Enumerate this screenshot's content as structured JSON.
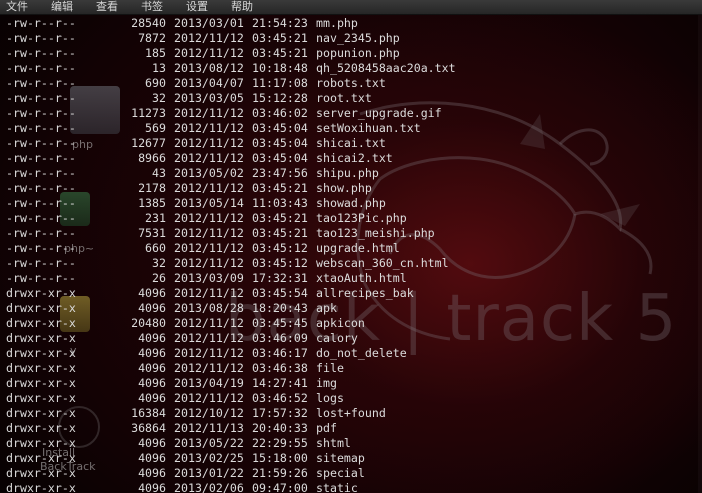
{
  "menubar": {
    "items": [
      "文件",
      "编辑",
      "查看",
      "书签",
      "设置",
      "帮助"
    ]
  },
  "desktop": {
    "watermark_text": "back | track 5",
    "icons": [
      {
        "label": "php"
      },
      {
        "label": "php~"
      },
      {
        "label": "y"
      },
      {
        "label": "Install"
      },
      {
        "label": "BackTrack"
      }
    ]
  },
  "listing": [
    {
      "perm": "-rw-r--r--",
      "size": "28540",
      "date": "2013/03/01",
      "time": "21:54:23",
      "name": "mm.php"
    },
    {
      "perm": "-rw-r--r--",
      "size": "7872",
      "date": "2012/11/12",
      "time": "03:45:21",
      "name": "nav_2345.php"
    },
    {
      "perm": "-rw-r--r--",
      "size": "185",
      "date": "2012/11/12",
      "time": "03:45:21",
      "name": "popunion.php"
    },
    {
      "perm": "-rw-r--r--",
      "size": "13",
      "date": "2013/08/12",
      "time": "10:18:48",
      "name": "qh_5208458aac20a.txt"
    },
    {
      "perm": "-rw-r--r--",
      "size": "690",
      "date": "2013/04/07",
      "time": "11:17:08",
      "name": "robots.txt"
    },
    {
      "perm": "-rw-r--r--",
      "size": "32",
      "date": "2013/03/05",
      "time": "15:12:28",
      "name": "root.txt"
    },
    {
      "perm": "-rw-r--r--",
      "size": "11273",
      "date": "2012/11/12",
      "time": "03:46:02",
      "name": "server_upgrade.gif"
    },
    {
      "perm": "-rw-r--r--",
      "size": "569",
      "date": "2012/11/12",
      "time": "03:45:04",
      "name": "setWoxihuan.txt"
    },
    {
      "perm": "-rw-r--r--",
      "size": "12677",
      "date": "2012/11/12",
      "time": "03:45:04",
      "name": "shicai.txt"
    },
    {
      "perm": "-rw-r--r--",
      "size": "8966",
      "date": "2012/11/12",
      "time": "03:45:04",
      "name": "shicai2.txt"
    },
    {
      "perm": "-rw-r--r--",
      "size": "43",
      "date": "2013/05/02",
      "time": "23:47:56",
      "name": "shipu.php"
    },
    {
      "perm": "-rw-r--r--",
      "size": "2178",
      "date": "2012/11/12",
      "time": "03:45:21",
      "name": "show.php"
    },
    {
      "perm": "-rw-r--r--",
      "size": "1385",
      "date": "2013/05/14",
      "time": "11:03:43",
      "name": "showad.php"
    },
    {
      "perm": "-rw-r--r--",
      "size": "231",
      "date": "2012/11/12",
      "time": "03:45:21",
      "name": "tao123Pic.php"
    },
    {
      "perm": "-rw-r--r--",
      "size": "7531",
      "date": "2012/11/12",
      "time": "03:45:21",
      "name": "tao123_meishi.php"
    },
    {
      "perm": "-rw-r--r--",
      "size": "660",
      "date": "2012/11/12",
      "time": "03:45:12",
      "name": "upgrade.html"
    },
    {
      "perm": "-rw-r--r--",
      "size": "32",
      "date": "2012/11/12",
      "time": "03:45:12",
      "name": "webscan_360_cn.html"
    },
    {
      "perm": "-rw-r--r--",
      "size": "26",
      "date": "2013/03/09",
      "time": "17:32:31",
      "name": "xtaoAuth.html"
    },
    {
      "perm": "drwxr-xr-x",
      "size": "4096",
      "date": "2012/11/12",
      "time": "03:45:54",
      "name": "allrecipes_bak"
    },
    {
      "perm": "drwxr-xr-x",
      "size": "4096",
      "date": "2013/08/28",
      "time": "18:20:43",
      "name": "apk"
    },
    {
      "perm": "drwxr-xr-x",
      "size": "20480",
      "date": "2012/11/12",
      "time": "03:45:45",
      "name": "apkicon"
    },
    {
      "perm": "drwxr-xr-x",
      "size": "4096",
      "date": "2012/11/12",
      "time": "03:46:09",
      "name": "calory"
    },
    {
      "perm": "drwxr-xr-x",
      "size": "4096",
      "date": "2012/11/12",
      "time": "03:46:17",
      "name": "do_not_delete"
    },
    {
      "perm": "drwxr-xr-x",
      "size": "4096",
      "date": "2012/11/12",
      "time": "03:46:38",
      "name": "file"
    },
    {
      "perm": "drwxr-xr-x",
      "size": "4096",
      "date": "2013/04/19",
      "time": "14:27:41",
      "name": "img"
    },
    {
      "perm": "drwxr-xr-x",
      "size": "4096",
      "date": "2012/11/12",
      "time": "03:46:52",
      "name": "logs"
    },
    {
      "perm": "drwxr-xr-x",
      "size": "16384",
      "date": "2012/10/12",
      "time": "17:57:32",
      "name": "lost+found"
    },
    {
      "perm": "drwxr-xr-x",
      "size": "36864",
      "date": "2012/11/13",
      "time": "20:40:33",
      "name": "pdf"
    },
    {
      "perm": "drwxr-xr-x",
      "size": "4096",
      "date": "2013/05/22",
      "time": "22:29:55",
      "name": "shtml"
    },
    {
      "perm": "drwxr-xr-x",
      "size": "4096",
      "date": "2013/02/25",
      "time": "15:18:00",
      "name": "sitemap"
    },
    {
      "perm": "drwxr-xr-x",
      "size": "4096",
      "date": "2013/01/22",
      "time": "21:59:26",
      "name": "special"
    },
    {
      "perm": "drwxr-xr-x",
      "size": "4096",
      "date": "2013/02/06",
      "time": "09:47:00",
      "name": "static"
    }
  ],
  "colors": {
    "menubar_bg": "#2e2e2e",
    "terminal_text": "#dcdcdc",
    "desktop_bg": "#2a0508",
    "watermark": "#78706f"
  }
}
